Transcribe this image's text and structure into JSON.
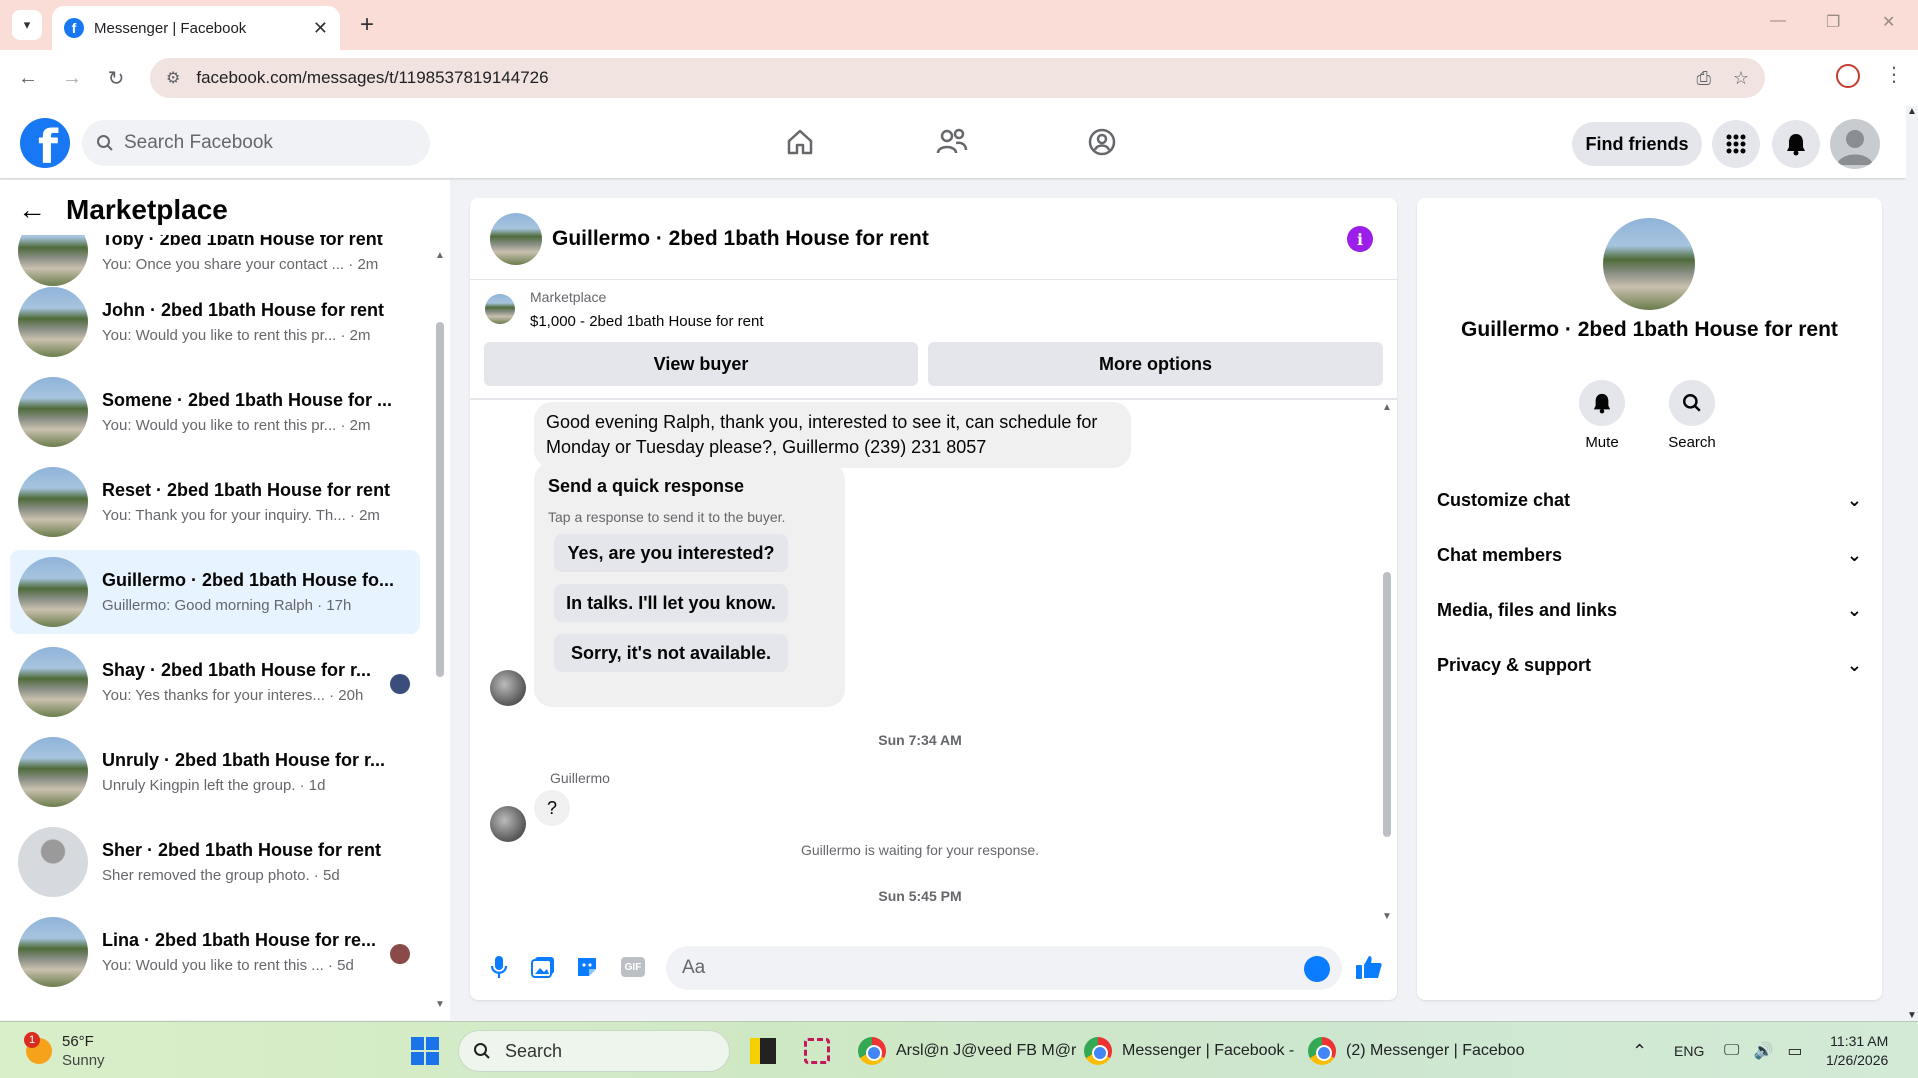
{
  "browser": {
    "tab_title": "Messenger | Facebook",
    "url": "facebook.com/messages/t/1198537819144726"
  },
  "header": {
    "search_placeholder": "Search Facebook",
    "find_friends": "Find friends"
  },
  "sidebar": {
    "title": "Marketplace",
    "conversations": [
      {
        "name": "Toby · 2bed 1bath House for rent",
        "preview": "You: Once you share your contact ...",
        "time": "2m"
      },
      {
        "name": "John · 2bed 1bath House for rent",
        "preview": "You: Would you like to rent this pr...",
        "time": "2m"
      },
      {
        "name": "Somene · 2bed 1bath House for ...",
        "preview": "You: Would you like to rent this pr...",
        "time": "2m"
      },
      {
        "name": "Reset · 2bed 1bath House for rent",
        "preview": "You: Thank you for your inquiry. Th...",
        "time": "2m"
      },
      {
        "name": "Guillermo · 2bed 1bath House fo...",
        "preview": "Guillermo: Good morning Ralph",
        "time": "17h"
      },
      {
        "name": "Shay · 2bed 1bath House for r...",
        "preview": "You: Yes thanks for your interes...",
        "time": "20h"
      },
      {
        "name": "Unruly · 2bed 1bath House for r...",
        "preview": "Unruly Kingpin left the group.",
        "time": "1d"
      },
      {
        "name": "Sher · 2bed 1bath House for rent",
        "preview": "Sher removed the group photo.",
        "time": "5d"
      },
      {
        "name": "Lina · 2bed 1bath House for re...",
        "preview": "You: Would you like to rent this ...",
        "time": "5d"
      }
    ]
  },
  "chat": {
    "title": "Guillermo · 2bed 1bath House for rent",
    "listing_category": "Marketplace",
    "listing_title": "$1,000 - 2bed 1bath House for rent",
    "view_buyer": "View buyer",
    "more_options": "More options",
    "message_1": "Good evening Ralph, thank you, interested to see it, can schedule for Monday or Tuesday please?, Guillermo (239) 231 8057",
    "quick_title": "Send a quick response",
    "quick_sub": "Tap a response to send it to the buyer.",
    "quick_options": [
      "Yes, are you interested?",
      "In talks. I'll let you know.",
      "Sorry, it's not available."
    ],
    "timestamp_1": "Sun 7:34 AM",
    "sender": "Guillermo",
    "message_2": "?",
    "waiting": "Guillermo is waiting for your response.",
    "timestamp_2": "Sun 5:45 PM",
    "input_placeholder": "Aa"
  },
  "info": {
    "name": "Guillermo · 2bed 1bath House for rent",
    "mute": "Mute",
    "search": "Search",
    "sections": [
      "Customize chat",
      "Chat members",
      "Media, files and links",
      "Privacy & support"
    ]
  },
  "taskbar": {
    "weather_temp": "56°F",
    "weather_desc": "Sunny",
    "weather_badge": "1",
    "search": "Search",
    "apps": [
      "Arsl@n J@veed FB M@r",
      "Messenger | Facebook -",
      "(2) Messenger | Faceboo"
    ],
    "lang": "ENG",
    "time": "11:31 AM",
    "date": "1/26/2026"
  }
}
